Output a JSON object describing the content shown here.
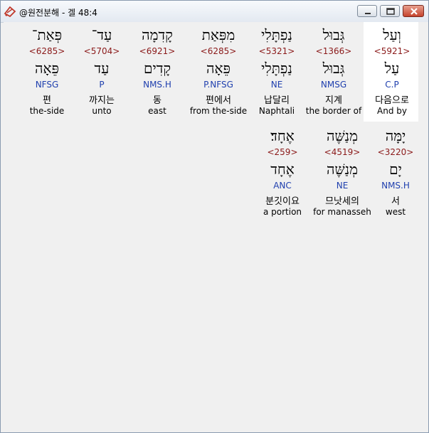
{
  "window": {
    "title": "@원전분해 - 겔 48:4"
  },
  "row1": [
    {
      "heb": "וְעַל",
      "strong": "<5921>",
      "lemma": "עַל",
      "morph": "C.P",
      "korean": "다음으로",
      "english": "And by"
    },
    {
      "heb": "גְּבוּל",
      "strong": "<1366>",
      "lemma": "גְּבוּל",
      "morph": "NMSG",
      "korean": "지계",
      "english": "the border of"
    },
    {
      "heb": "נַפְתָּלִי",
      "strong": "<5321>",
      "lemma": "נַפְתָּלִי",
      "morph": "NE",
      "korean": "납달리",
      "english": "Naphtali"
    },
    {
      "heb": "מִפְּאַת",
      "strong": "<6285>",
      "lemma": "פֵּאָה",
      "morph": "P.NFSG",
      "korean": "편에서",
      "english": "from the-side"
    },
    {
      "heb": "קָדִמָה",
      "strong": "<6921>",
      "lemma": "קָדִים",
      "morph": "NMS.H",
      "korean": "동",
      "english": "east"
    },
    {
      "heb": "עַד־",
      "strong": "<5704>",
      "lemma": "עַד",
      "morph": "P",
      "korean": "까지는",
      "english": "unto"
    },
    {
      "heb": "פְּאַת־",
      "strong": "<6285>",
      "lemma": "פֵּאָה",
      "morph": "NFSG",
      "korean": "편",
      "english": "the-side"
    }
  ],
  "row2": [
    {
      "heb": "יָמָּה",
      "strong": "<3220>",
      "lemma": "יָם",
      "morph": "NMS.H",
      "korean": "서",
      "english": "west"
    },
    {
      "heb": "מְנַשֶּׁה",
      "strong": "<4519>",
      "lemma": "מְנַשֶּׁה",
      "morph": "NE",
      "korean": "므낫세의",
      "english": "for manasseh"
    },
    {
      "heb": "אֶחָד׃",
      "strong": "<259>",
      "lemma": "אֶחָד",
      "morph": "ANC",
      "korean": "분깃이요",
      "english": "a portion"
    }
  ]
}
